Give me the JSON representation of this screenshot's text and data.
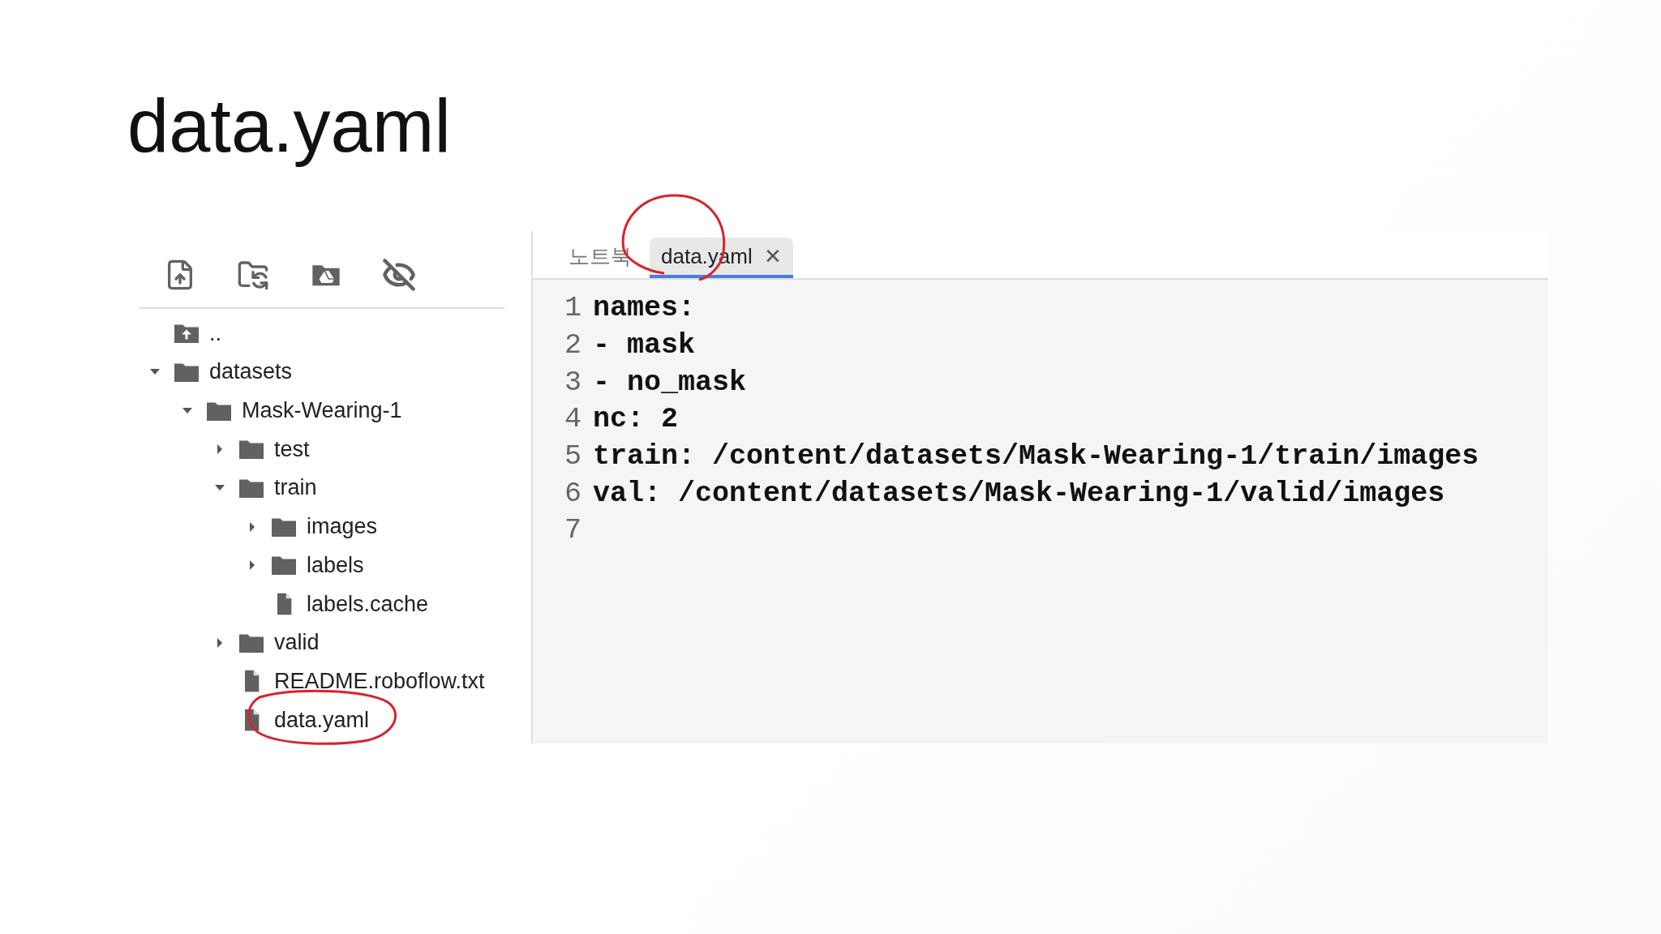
{
  "slide_title": "data.yaml",
  "toolbar": {
    "buttons": [
      {
        "kind": "upload"
      },
      {
        "kind": "refresh"
      },
      {
        "kind": "drive"
      },
      {
        "kind": "hide"
      }
    ]
  },
  "file_tree": [
    {
      "label": "..",
      "kind": "parent"
    },
    {
      "label": "datasets",
      "kind": "folder",
      "expanded": true,
      "children": [
        {
          "label": "Mask-Wearing-1",
          "kind": "folder",
          "expanded": true,
          "children": [
            {
              "label": "test",
              "kind": "folder",
              "expanded": false
            },
            {
              "label": "train",
              "kind": "folder",
              "expanded": true,
              "children": [
                {
                  "label": "images",
                  "kind": "folder",
                  "expanded": false
                },
                {
                  "label": "labels",
                  "kind": "folder",
                  "expanded": false
                },
                {
                  "label": "labels.cache",
                  "kind": "file"
                }
              ]
            },
            {
              "label": "valid",
              "kind": "folder",
              "expanded": false
            },
            {
              "label": "README.roboflow.txt",
              "kind": "file"
            },
            {
              "label": "data.yaml",
              "kind": "file",
              "annotated": true
            }
          ]
        }
      ]
    }
  ],
  "tabs": [
    {
      "label": "노트북",
      "selected": false,
      "closable": false,
      "annotated": false
    },
    {
      "label": "data.yaml",
      "selected": true,
      "closable": true,
      "annotated": true
    }
  ],
  "close_glyph": "✕",
  "code_lines": [
    {
      "number": "1",
      "text": "names:"
    },
    {
      "number": "2",
      "text": "- mask"
    },
    {
      "number": "3",
      "text": "- no_mask"
    },
    {
      "number": "4",
      "text": "nc: 2"
    },
    {
      "number": "5",
      "text": "train: /content/datasets/Mask-Wearing-1/train/images"
    },
    {
      "number": "6",
      "text": "val: /content/datasets/Mask-Wearing-1/valid/images"
    },
    {
      "number": "7"
    }
  ]
}
